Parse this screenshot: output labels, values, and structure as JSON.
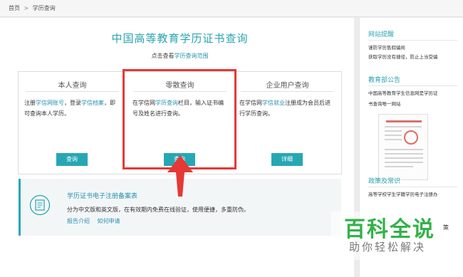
{
  "breadcrumb": {
    "home": "首页",
    "sep": ">",
    "current": "学历查询"
  },
  "title": "中国高等教育学历证书查询",
  "subline": {
    "prefix": "点击查看",
    "link": "学历查询范围"
  },
  "columns": [
    {
      "title": "本人查询",
      "text_parts": [
        "注册",
        "学信网账号",
        "，登录",
        "学信档案",
        "，即可查询本人学历。"
      ],
      "button": "查询"
    },
    {
      "title": "零散查询",
      "text_parts": [
        "在学信网",
        "学历查询",
        "栏目，输入证书编号及姓名进行查询。"
      ],
      "button": "查询"
    },
    {
      "title": "企业用户查询",
      "text_parts": [
        "在学信网",
        "学信就业",
        "注册成为会员后进行学历查询。"
      ],
      "button": "详细"
    }
  ],
  "register": {
    "title": "学历证书电子注册备案表",
    "desc": "分为中文版和英文版，在有效期内免费在线验证，使用便捷，多重防伪。",
    "links": [
      "报告介绍",
      "如何申请"
    ]
  },
  "sidebar": {
    "tips_heading": "网站提醒",
    "tips_lines": [
      "谨防学历售假骗局",
      "获取学历没有捷径，防止上当受骗"
    ],
    "notice_heading": "教育部公告",
    "notice_lines": [
      "中国高等教育学生信息网是学历证",
      "书查询唯一网站"
    ],
    "policy_heading": "政策及常识",
    "policy_line": "高等学校学生学籍学历电子注册办",
    "edge_text": "策"
  },
  "watermark": {
    "main": "百科全说",
    "sub": "助你轻松解决"
  },
  "colors": {
    "accent": "#27a7b4",
    "highlight": "#e53935",
    "link": "#2a8fb3",
    "watermark": "#33b24a"
  }
}
